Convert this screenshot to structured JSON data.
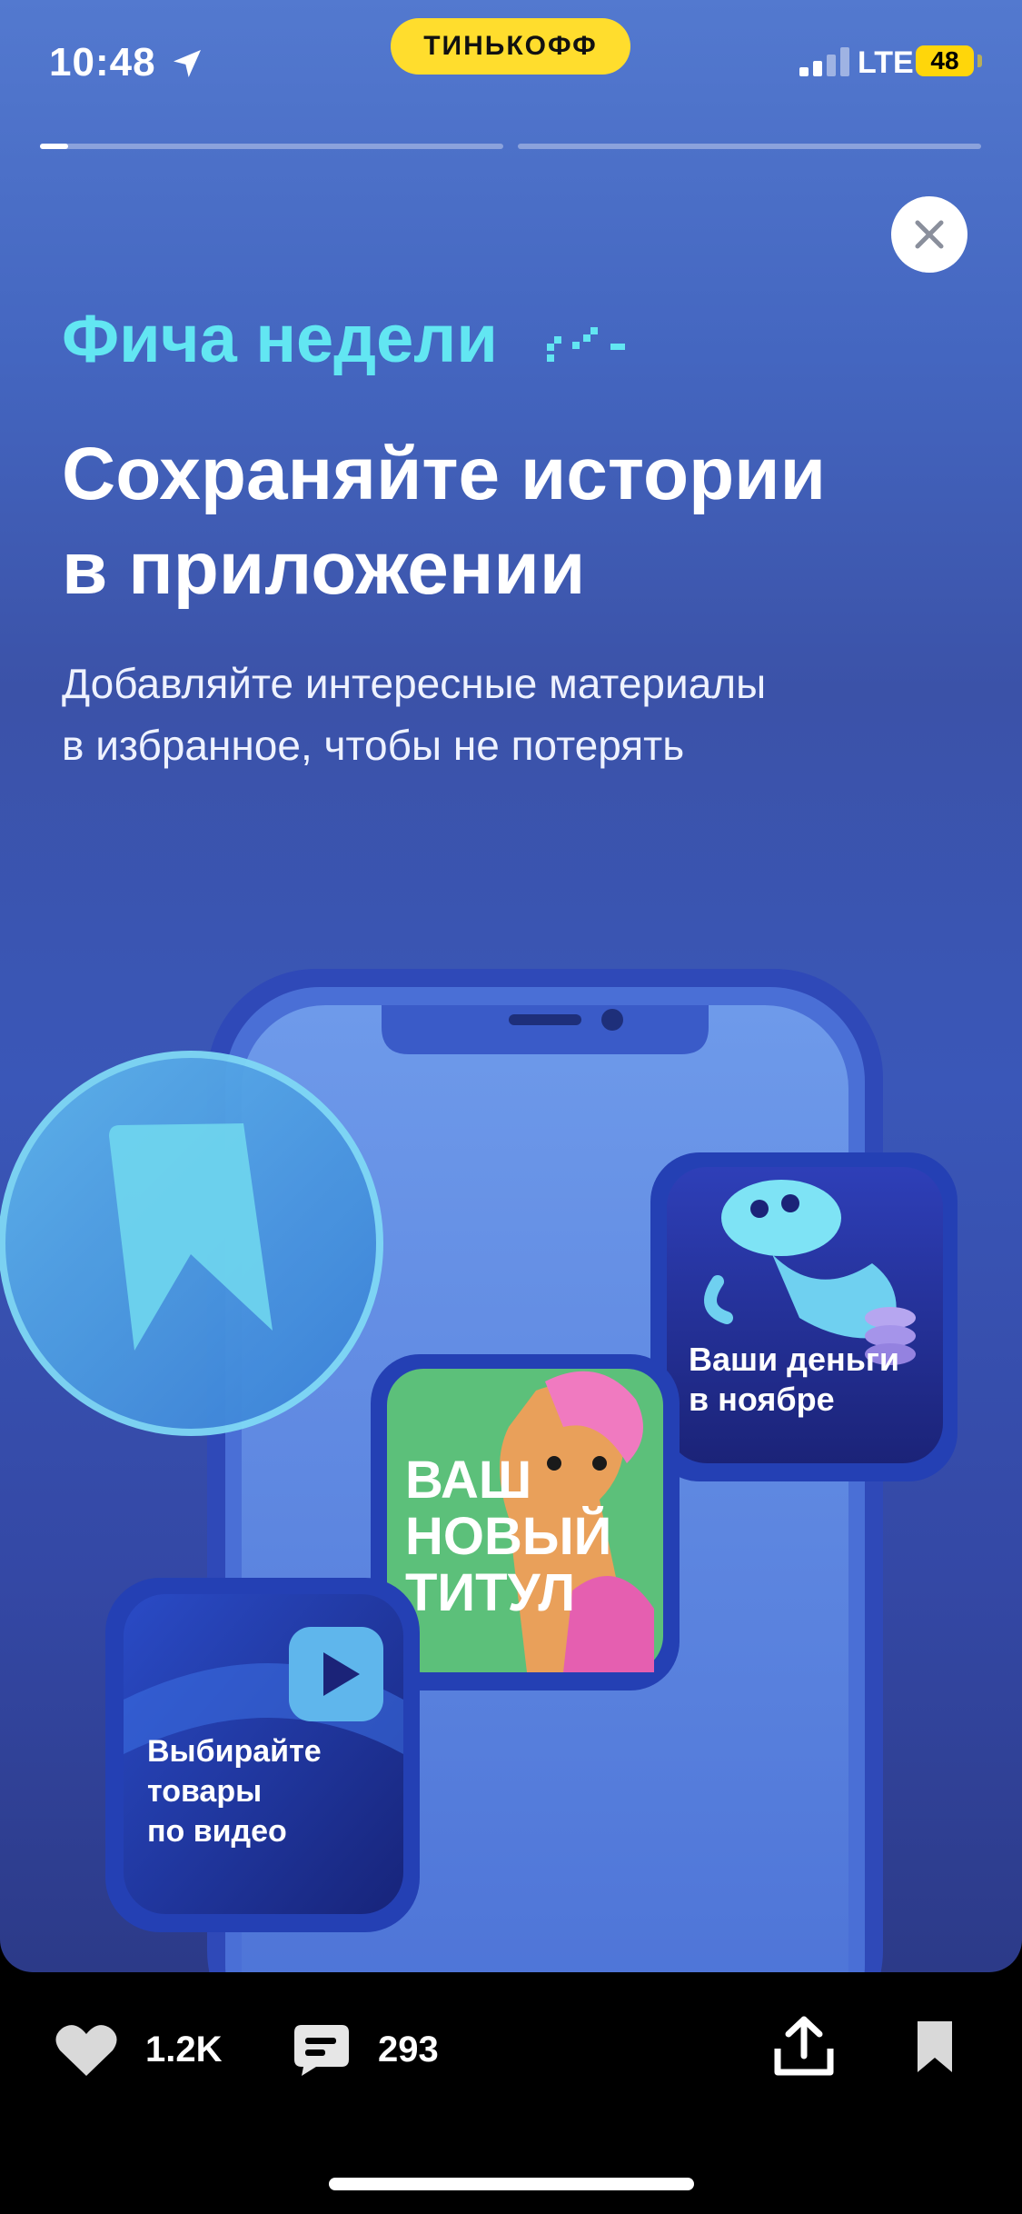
{
  "status_bar": {
    "time": "10:48",
    "brand": "ТИНЬКОФФ",
    "network": "LTE",
    "battery": "48"
  },
  "story": {
    "progress": [
      0.06,
      0.0
    ],
    "eyebrow": "Фича недели",
    "headline_line1": "Сохраняйте истории",
    "headline_line2": "в приложении",
    "subtitle_line1": "Добавляйте интересные материалы",
    "subtitle_line2": "в избранное, чтобы не потерять",
    "cards": {
      "money_line1": "Ваши деньги",
      "money_line2": "в ноябре",
      "title_line1": "ВАШ",
      "title_line2": "НОВЫЙ",
      "title_line3": "ТИТУЛ",
      "video_line1": "Выбирайте",
      "video_line2": "товары",
      "video_line3": "по видео"
    }
  },
  "actions": {
    "likes": "1.2K",
    "comments": "293"
  },
  "icons": [
    "location-arrow-icon",
    "signal-icon",
    "close-icon",
    "bookmark-icon",
    "play-icon",
    "heart-icon",
    "comment-icon",
    "share-icon",
    "bookmark-outline-icon"
  ],
  "colors": {
    "brand_yellow": "#ffdd2d",
    "accent_cyan": "#62e6f2",
    "background_blue": "#3b52a8"
  }
}
